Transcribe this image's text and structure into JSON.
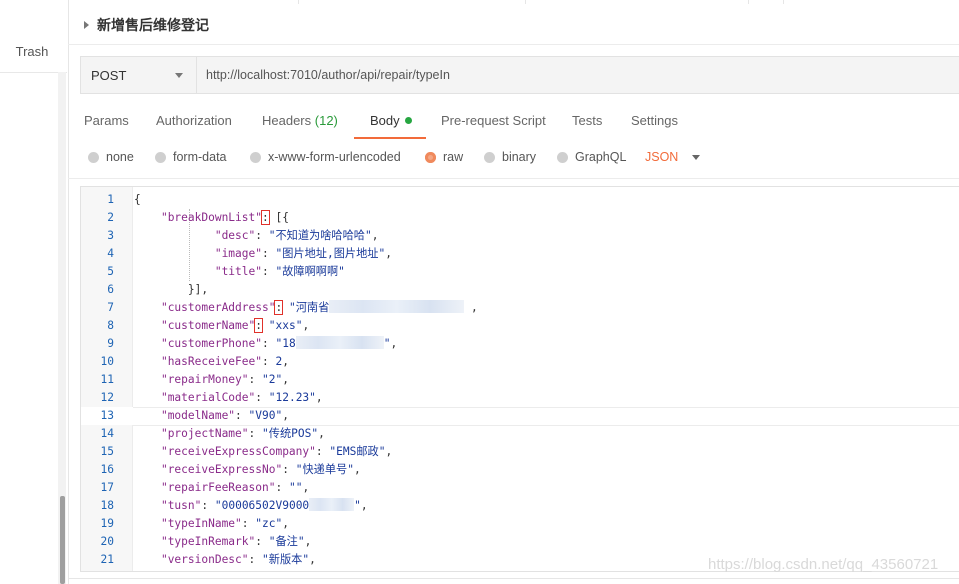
{
  "sidebar": {
    "trash_label": "Trash"
  },
  "request": {
    "title": "新增售后维修登记",
    "method": "POST",
    "url": "http://localhost:7010/author/api/repair/typeIn"
  },
  "tabs": [
    {
      "label": "Params"
    },
    {
      "label": "Authorization"
    },
    {
      "label": "Headers",
      "count": "(12)"
    },
    {
      "label": "Body",
      "active": true
    },
    {
      "label": "Pre-request Script"
    },
    {
      "label": "Tests"
    },
    {
      "label": "Settings"
    }
  ],
  "body_types": [
    {
      "label": "none"
    },
    {
      "label": "form-data"
    },
    {
      "label": "x-www-form-urlencoded"
    },
    {
      "label": "raw",
      "selected": true
    },
    {
      "label": "binary"
    },
    {
      "label": "GraphQL"
    }
  ],
  "format": "JSON",
  "colors": {
    "accent": "#f26b3a",
    "active_dot": "#26a641",
    "line_numbers": "#1e64b4"
  },
  "code_lines": [
    {
      "n": "1",
      "text": "{"
    },
    {
      "n": "2",
      "key": "\"breakDownList\"",
      "rest": "[{"
    },
    {
      "n": "3",
      "key": "\"desc\"",
      "value": "\"不知道为啥哈哈哈\"",
      "tail": ","
    },
    {
      "n": "4",
      "key": "\"image\"",
      "value": "\"图片地址,图片地址\"",
      "tail": ","
    },
    {
      "n": "5",
      "key": "\"title\"",
      "value": "\"故障啊啊啊\""
    },
    {
      "n": "6",
      "text": "}],"
    },
    {
      "n": "7",
      "key": "\"customerAddress\"",
      "value": "\"河南省",
      "tail": ","
    },
    {
      "n": "8",
      "key": "\"customerName\"",
      "value": "\"xxs\"",
      "tail": ","
    },
    {
      "n": "9",
      "key": "\"customerPhone\"",
      "value": "\"18",
      "value_end": "\"",
      "tail": ","
    },
    {
      "n": "10",
      "key": "\"hasReceiveFee\"",
      "value": "2",
      "tail": ","
    },
    {
      "n": "11",
      "key": "\"repairMoney\"",
      "value": "\"2\"",
      "tail": ","
    },
    {
      "n": "12",
      "key": "\"materialCode\"",
      "value": "\"12.23\"",
      "tail": ","
    },
    {
      "n": "13",
      "key": "\"modelName\"",
      "value": "\"V90\"",
      "tail": ","
    },
    {
      "n": "14",
      "key": "\"projectName\"",
      "value": "\"传统POS\"",
      "tail": ","
    },
    {
      "n": "15",
      "key": "\"receiveExpressCompany\"",
      "value": "\"EMS邮政\"",
      "tail": ","
    },
    {
      "n": "16",
      "key": "\"receiveExpressNo\"",
      "value": "\"快递单号\"",
      "tail": ","
    },
    {
      "n": "17",
      "key": "\"repairFeeReason\"",
      "value": "\"\"",
      "tail": ","
    },
    {
      "n": "18",
      "key": "\"tusn\"",
      "value": "\"00006502V9000",
      "value_end": "\"",
      "tail": ","
    },
    {
      "n": "19",
      "key": "\"typeInName\"",
      "value": "\"zc\"",
      "tail": ","
    },
    {
      "n": "20",
      "key": "\"typeInRemark\"",
      "value": "\"备注\"",
      "tail": ","
    },
    {
      "n": "21",
      "key": "\"versionDesc\"",
      "value": "\"新版本\"",
      "tail": ","
    }
  ],
  "watermark": "https://blog.csdn.net/qq_43560721"
}
